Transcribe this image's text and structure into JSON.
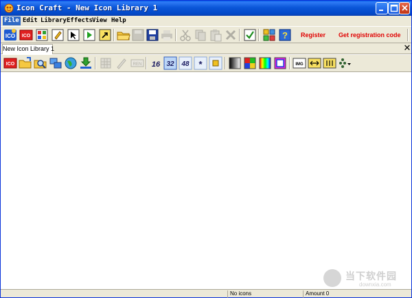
{
  "window": {
    "title": "Icon Craft - New Icon Library 1",
    "controls": {
      "minimize": "minimize",
      "maximize": "maximize",
      "close": "close"
    }
  },
  "menu": {
    "items": [
      "File",
      "Edit",
      "Library",
      "Effects",
      "View",
      "Help"
    ],
    "active_index": 0
  },
  "toolbar_main": {
    "icons": [
      "icon-logo",
      "new-ico",
      "new-gallery",
      "edit-icon",
      "arrow-tool",
      "play-tool",
      "export-tool",
      "open-folder",
      "save-disabled",
      "save",
      "print-disabled",
      "cut-disabled",
      "copy-disabled",
      "paste-disabled",
      "delete-disabled",
      "check",
      "settings-grid",
      "help"
    ],
    "register_label": "Register",
    "get_code_label": "Get registration code"
  },
  "tabs": {
    "items": [
      "New Icon Library 1"
    ],
    "close_glyph": "✕"
  },
  "toolbar_library": {
    "icons": [
      "ico",
      "open-file",
      "search",
      "network",
      "globe",
      "download",
      "grid-disabled",
      "edit-disabled",
      "rename-disabled",
      "size-16",
      "size-32",
      "size-48",
      "size-custom",
      "size-square",
      "grayscale",
      "color-palette",
      "spectrum",
      "frame",
      "img",
      "resize-h",
      "resize-v",
      "effects-dropdown"
    ],
    "size_labels": {
      "s16": "16",
      "s32": "32",
      "s48": "48",
      "custom": "*",
      "rename": "REN",
      "img": "IMG"
    }
  },
  "statusbar": {
    "empty": "",
    "icons_status": "No icons",
    "amount": "Amount 0"
  },
  "watermark": {
    "text": "当下软件园",
    "url": "downxia.com"
  },
  "colors": {
    "titlebar": "#0b56d8",
    "menu_highlight": "#316ac5",
    "register_red": "#e00000",
    "chrome": "#ece9d8"
  }
}
